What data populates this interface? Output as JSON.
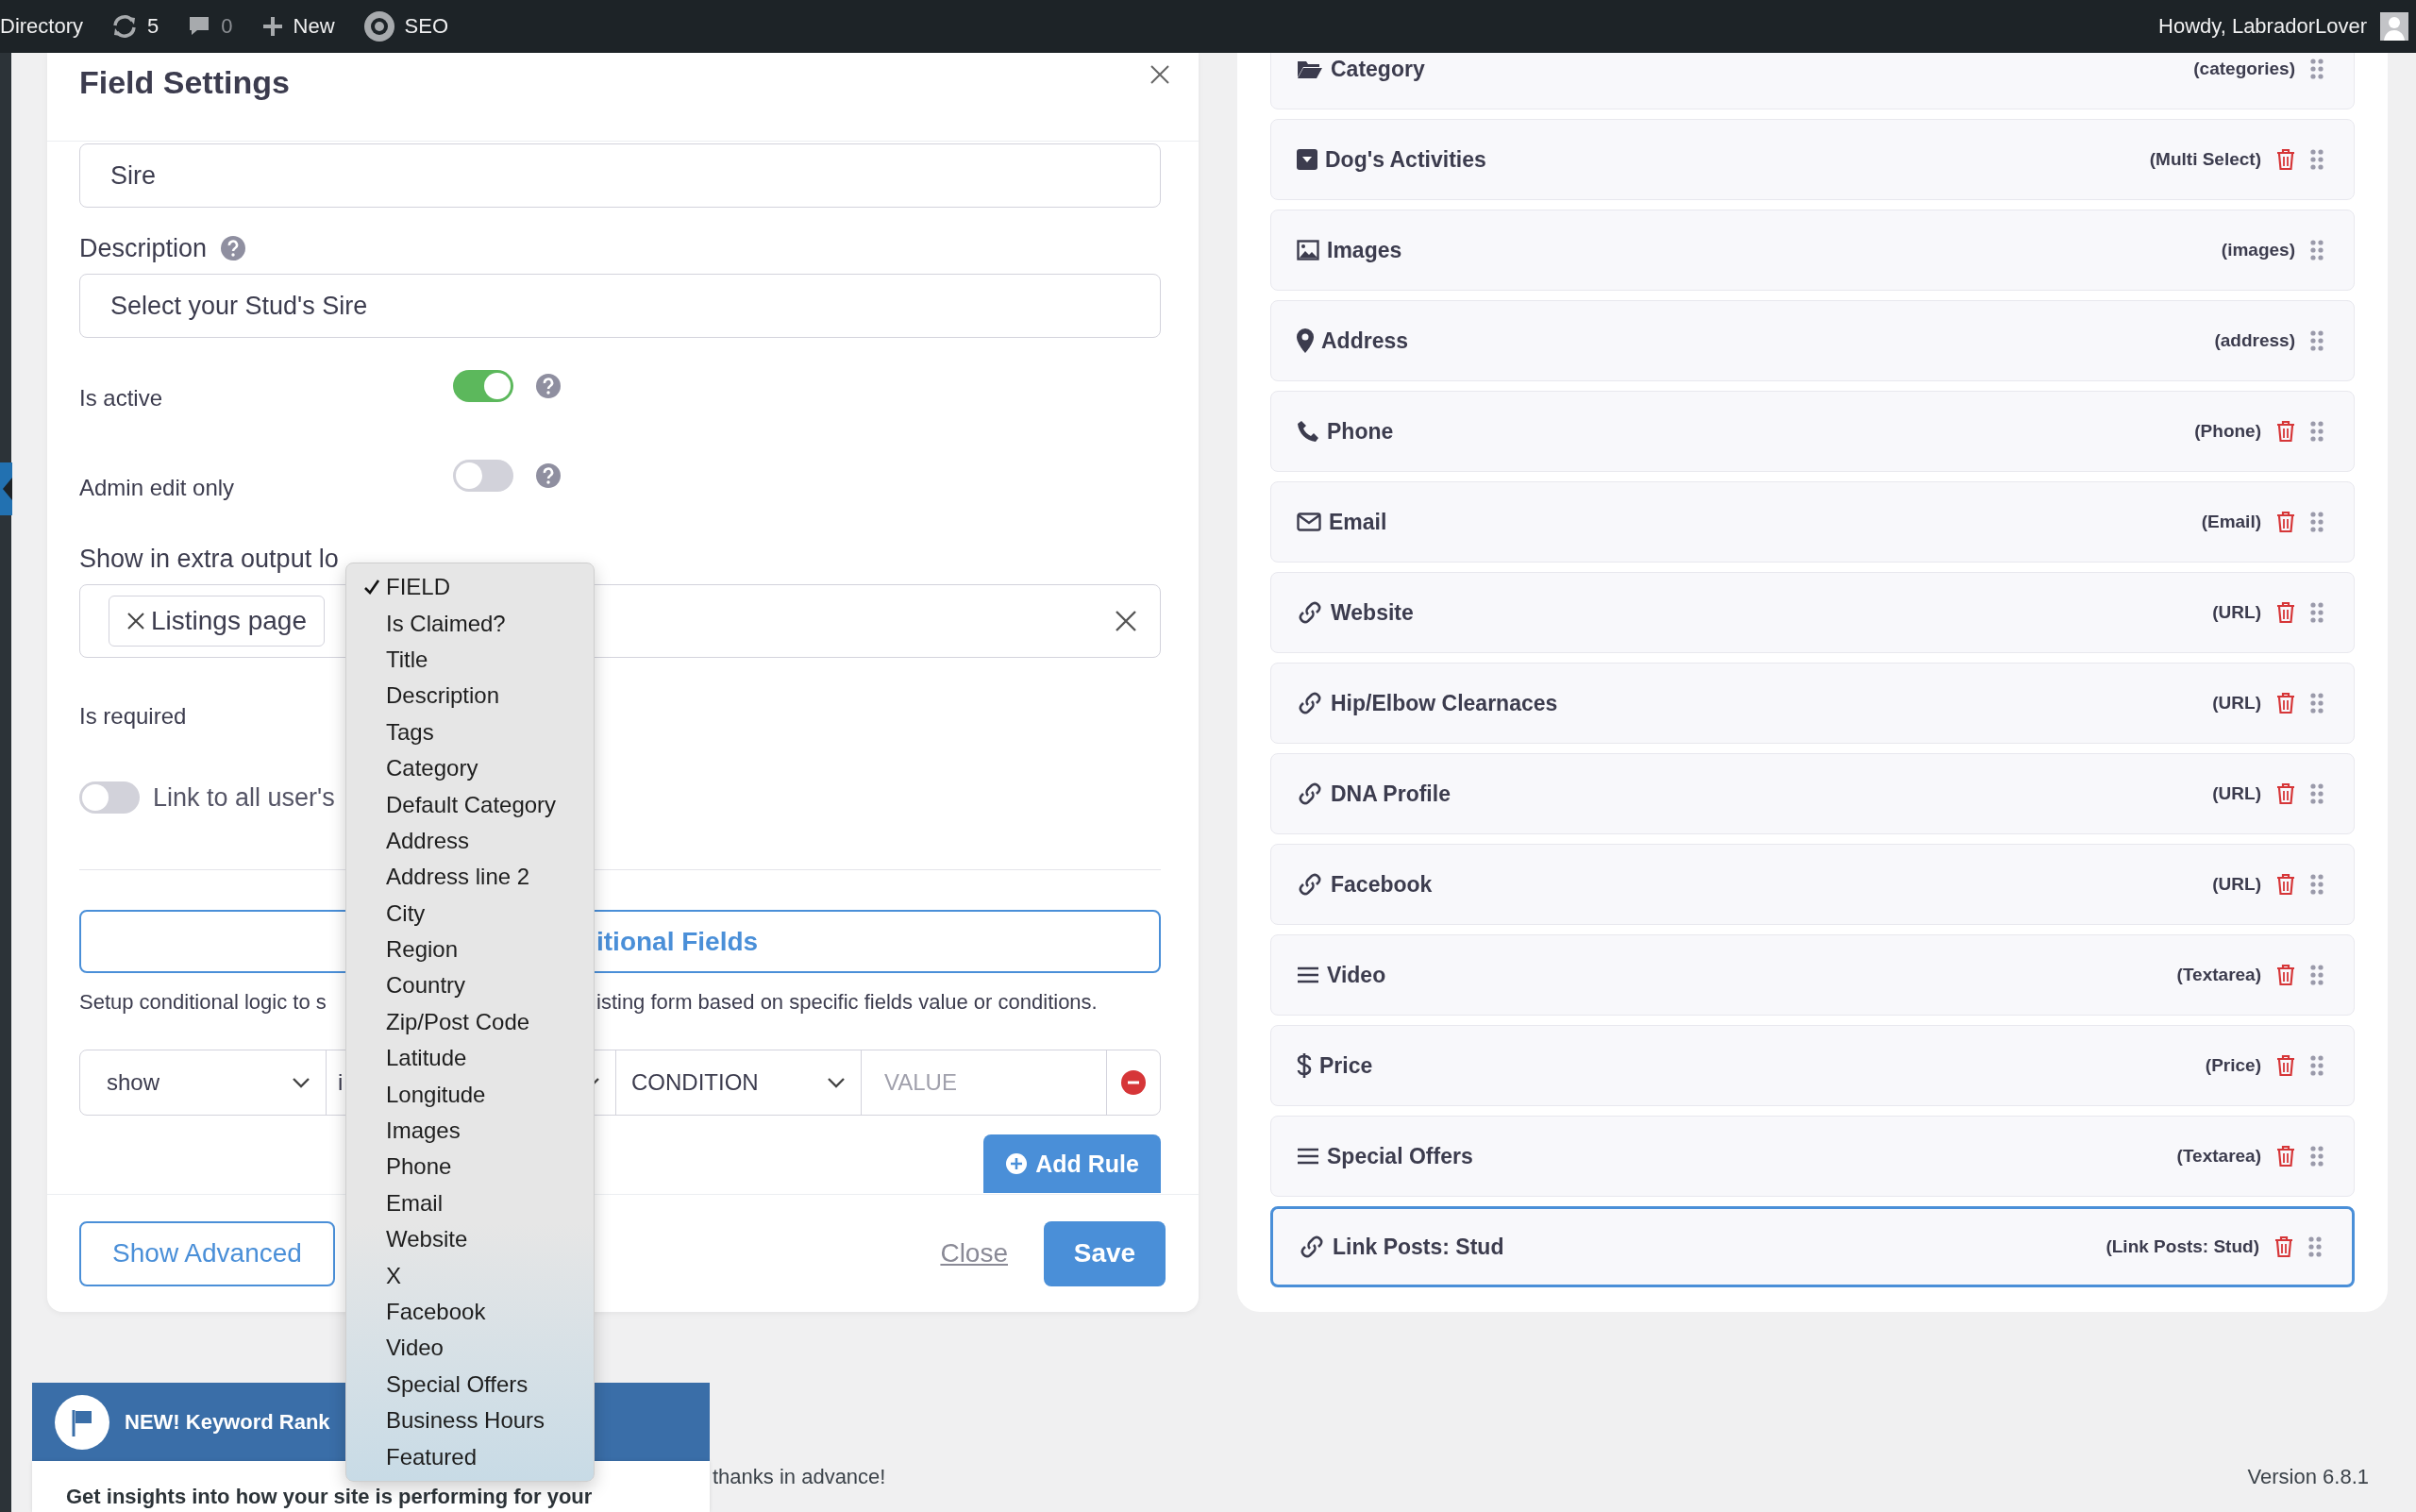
{
  "top_bar": {
    "items": [
      {
        "kind": "text",
        "label": "Directory"
      },
      {
        "kind": "updates",
        "label": "5"
      },
      {
        "kind": "comments",
        "label": "0"
      },
      {
        "kind": "new",
        "label": "New"
      },
      {
        "kind": "seo",
        "label": "SEO"
      }
    ],
    "greeting": "Howdy, LabradorLover"
  },
  "field_settings": {
    "title": "Field Settings",
    "name_value": "Sire",
    "description_label": "Description",
    "description_value": "Select your Stud's Sire",
    "toggles": [
      {
        "label": "Is active",
        "on": true
      },
      {
        "label": "Admin edit only",
        "on": false
      }
    ],
    "output_location": {
      "label": "Show in extra output lo",
      "chips": [
        "Listings page"
      ]
    },
    "required_label": "Is required",
    "link_toggle": {
      "label": "Link to all user's",
      "on": false
    },
    "conditional_button": "itional Fields",
    "conditional_help": [
      "Setup conditional logic to s",
      "isting form based on specific fields value or conditions."
    ],
    "rule": {
      "action": "show",
      "field": "i",
      "condition": "CONDITION",
      "value_placeholder": "VALUE"
    },
    "add_rule": "Add Rule",
    "show_advanced": "Show Advanced",
    "close": "Close",
    "save": "Save"
  },
  "field_dropdown": [
    {
      "label": "FIELD",
      "selected": true
    },
    {
      "label": "Is Claimed?",
      "selected": false
    },
    {
      "label": "Title",
      "selected": false
    },
    {
      "label": "Description",
      "selected": false
    },
    {
      "label": "Tags",
      "selected": false
    },
    {
      "label": "Category",
      "selected": false
    },
    {
      "label": "Default Category",
      "selected": false
    },
    {
      "label": "Address",
      "selected": false
    },
    {
      "label": "Address line 2",
      "selected": false
    },
    {
      "label": "City",
      "selected": false
    },
    {
      "label": "Region",
      "selected": false
    },
    {
      "label": "Country",
      "selected": false
    },
    {
      "label": "Zip/Post Code",
      "selected": false
    },
    {
      "label": "Latitude",
      "selected": false
    },
    {
      "label": "Longitude",
      "selected": false
    },
    {
      "label": "Images",
      "selected": false
    },
    {
      "label": "Phone",
      "selected": false
    },
    {
      "label": "Email",
      "selected": false
    },
    {
      "label": "Website",
      "selected": false
    },
    {
      "label": "X",
      "selected": false
    },
    {
      "label": "Facebook",
      "selected": false
    },
    {
      "label": "Video",
      "selected": false
    },
    {
      "label": "Special Offers",
      "selected": false
    },
    {
      "label": "Business Hours",
      "selected": false
    },
    {
      "label": "Featured",
      "selected": false
    }
  ],
  "fields": [
    {
      "name": "Category",
      "type": "(categories)",
      "kind": "folder",
      "deletable": false,
      "selected": false
    },
    {
      "name": "Dog's Activities",
      "type": "(Multi Select)",
      "kind": "select",
      "deletable": true,
      "selected": false
    },
    {
      "name": "Images",
      "type": "(images)",
      "kind": "image",
      "deletable": false,
      "selected": false
    },
    {
      "name": "Address",
      "type": "(address)",
      "kind": "pin",
      "deletable": false,
      "selected": false
    },
    {
      "name": "Phone",
      "type": "(Phone)",
      "kind": "phone",
      "deletable": true,
      "selected": false
    },
    {
      "name": "Email",
      "type": "(Email)",
      "kind": "envelope",
      "deletable": true,
      "selected": false
    },
    {
      "name": "Website",
      "type": "(URL)",
      "kind": "link",
      "deletable": true,
      "selected": false
    },
    {
      "name": "Hip/Elbow Clearnaces",
      "type": "(URL)",
      "kind": "link",
      "deletable": true,
      "selected": false
    },
    {
      "name": "DNA Profile",
      "type": "(URL)",
      "kind": "link",
      "deletable": true,
      "selected": false
    },
    {
      "name": "Facebook",
      "type": "(URL)",
      "kind": "link",
      "deletable": true,
      "selected": false
    },
    {
      "name": "Video",
      "type": "(Textarea)",
      "kind": "lines",
      "deletable": true,
      "selected": false
    },
    {
      "name": "Price",
      "type": "(Price)",
      "kind": "dollar",
      "deletable": true,
      "selected": false
    },
    {
      "name": "Special Offers",
      "type": "(Textarea)",
      "kind": "lines",
      "deletable": true,
      "selected": false
    },
    {
      "name": "Link Posts: Stud",
      "type": "(Link Posts: Stud)",
      "kind": "link",
      "deletable": true,
      "selected": true
    }
  ],
  "notice": {
    "title": "NEW! Keyword Rank",
    "text": "Get insights into how your site is performing for your"
  },
  "footer": {
    "thanks": "thanks in advance!",
    "version": "Version 6.8.1"
  }
}
